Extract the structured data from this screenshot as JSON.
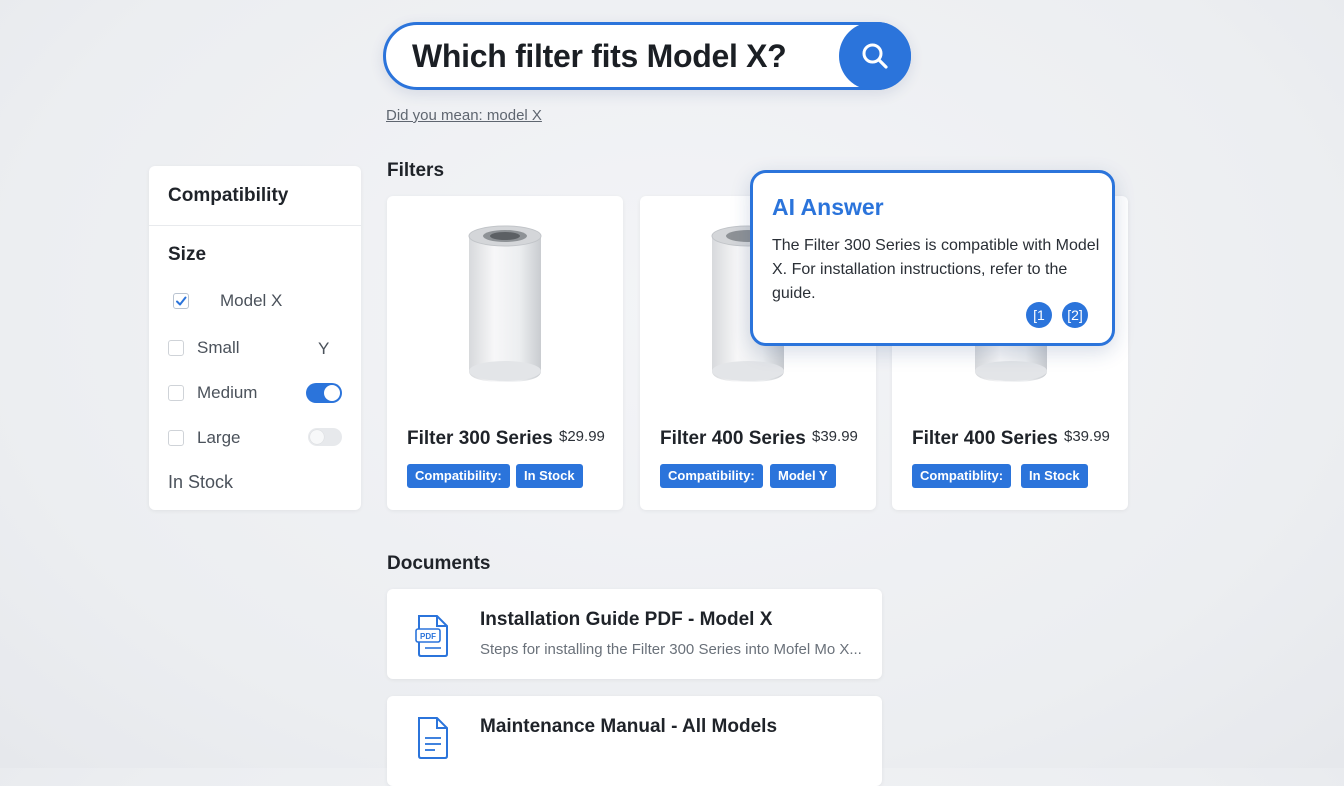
{
  "search": {
    "query": "Which filter fits Model X?",
    "did_you_mean": "Did you mean: model X",
    "icon": "search-icon"
  },
  "sidebar": {
    "title": "Compatibility",
    "size_heading": "Size",
    "options": [
      {
        "label": "Model X",
        "checked": true
      },
      {
        "label": "Small",
        "checked": false
      },
      {
        "label": "Medium",
        "checked": false
      },
      {
        "label": "Large",
        "checked": false
      }
    ],
    "extra_label": "Y",
    "toggles": [
      {
        "name": "medium-toggle",
        "on": true
      },
      {
        "name": "large-toggle",
        "on": false
      }
    ],
    "in_stock": "In Stock"
  },
  "filters": {
    "heading": "Filters",
    "products": [
      {
        "name": "Filter 300 Series",
        "price": "$29.99",
        "tags": [
          "Compatibility:",
          "In Stock"
        ]
      },
      {
        "name": "Filter 400 Series",
        "price": "$39.99",
        "tags": [
          "Compatibility:",
          "Model Y"
        ]
      },
      {
        "name": "Filter 400 Series",
        "price": "$39.99",
        "tags": [
          "Compatiblity:",
          "In Stock"
        ]
      }
    ]
  },
  "ai_answer": {
    "title": "AI Answer",
    "text": "The Filter 300 Series is compatible with Model X. For installation instructions, refer to the guide.",
    "citations": [
      "[1",
      "[2]"
    ]
  },
  "documents": {
    "heading": "Documents",
    "items": [
      {
        "title": "Installation Guide PDF - Model X",
        "description": "Steps for installing the Filter 300 Series into Mofel Mo X...",
        "icon": "pdf-file-icon"
      },
      {
        "title": "Maintenance Manual - All Models",
        "description": "",
        "icon": "document-icon"
      }
    ]
  },
  "colors": {
    "accent": "#2b74db",
    "background": "#eceef1",
    "card": "#ffffff"
  }
}
